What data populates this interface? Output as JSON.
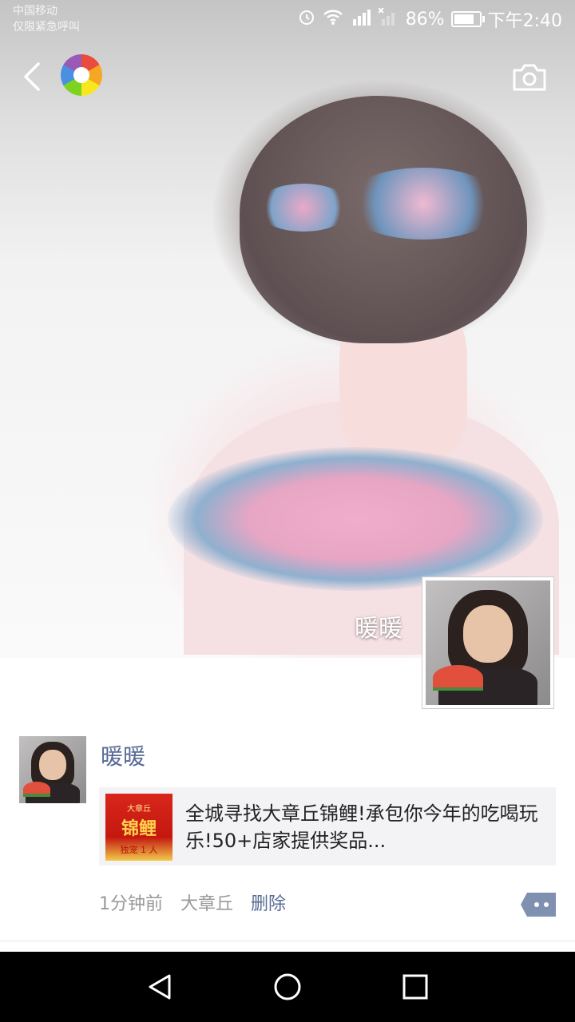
{
  "status_bar": {
    "carrier": "中国移动",
    "carrier_note": "仅限紧急呼叫",
    "battery": "86%",
    "time": "下午2:40",
    "icons": [
      "alarm-icon",
      "wifi-icon",
      "4g-signal-icon",
      "no-sim-signal-icon",
      "battery-icon"
    ]
  },
  "header": {
    "back_icon": "chevron-left-icon",
    "logo_icon": "wechat-moments-logo-icon",
    "camera_icon": "camera-icon"
  },
  "cover": {
    "user_name": "暖暖"
  },
  "post": {
    "user_name": "暖暖",
    "link": {
      "thumb_line1": "大章丘",
      "thumb_line2": "锦鲤",
      "thumb_line3": "独宠 1 人",
      "title": "全城寻找大章丘锦鲤!承包你今年的吃喝玩乐!50+店家提供奖品..."
    },
    "time": "1分钟前",
    "location": "大章丘",
    "delete_label": "删除",
    "more_icon": "comment-more-icon"
  },
  "nav_bar": {
    "icons": [
      "back-triangle-icon",
      "home-circle-icon",
      "recents-square-icon"
    ]
  },
  "colors": {
    "link_blue": "#576b95",
    "meta_gray": "#999999",
    "nav_black": "#000000"
  }
}
